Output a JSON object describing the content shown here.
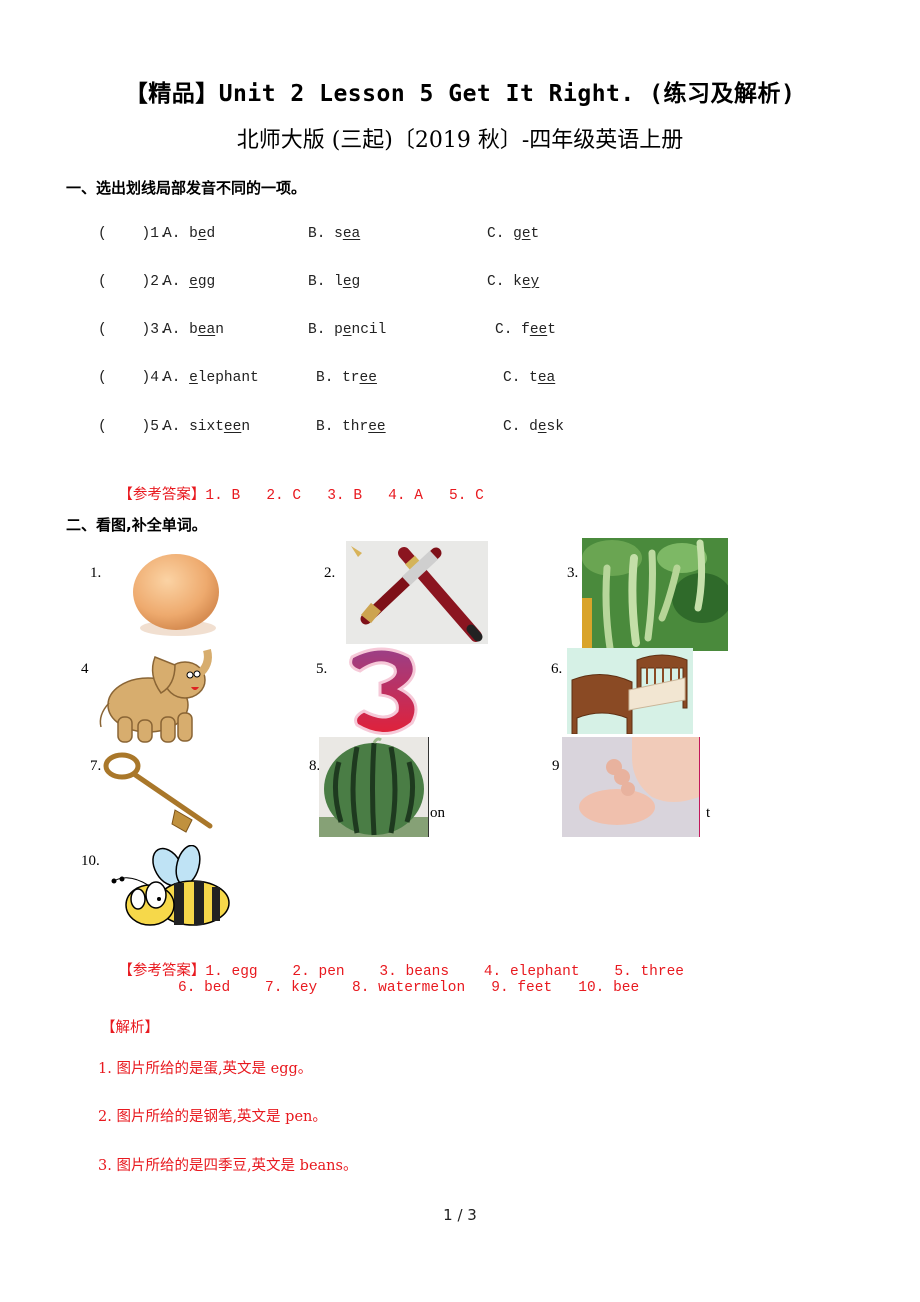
{
  "document": {
    "title_line1": "【精品】Unit 2 Lesson 5 Get It Right. (练习及解析)",
    "title_line2": "北师大版 (三起)〔2019 秋〕-四年级英语上册",
    "page_indicator": "1 / 3"
  },
  "section1": {
    "heading": "一、选出划线局部发音不同的一项。",
    "questions": [
      {
        "blank": "(    )",
        "num": "1.",
        "a": {
          "label": "A.",
          "pre": "b",
          "u": "e",
          "post": "d"
        },
        "b": {
          "label": "B.",
          "pre": "s",
          "u": "ea",
          "post": ""
        },
        "c": {
          "label": "C.",
          "pre": "g",
          "u": "e",
          "post": "t"
        }
      },
      {
        "blank": "(    )",
        "num": "2.",
        "a": {
          "label": "A.",
          "pre": "",
          "u": "e",
          "post": "gg"
        },
        "b": {
          "label": "B.",
          "pre": "l",
          "u": "e",
          "post": "g"
        },
        "c": {
          "label": "C.",
          "pre": "k",
          "u": "ey",
          "post": ""
        }
      },
      {
        "blank": "(    )",
        "num": "3.",
        "a": {
          "label": "A.",
          "pre": "b",
          "u": "ea",
          "post": "n"
        },
        "b": {
          "label": "B.",
          "pre": "p",
          "u": "e",
          "post": "ncil"
        },
        "c": {
          "label": "C.",
          "pre": "f",
          "u": "ee",
          "post": "t"
        }
      },
      {
        "blank": "(    )",
        "num": "4.",
        "a": {
          "label": "A.",
          "pre": "",
          "u": "e",
          "post": "lephant"
        },
        "b": {
          "label": "B.",
          "pre": "tr",
          "u": "ee",
          "post": ""
        },
        "c": {
          "label": "C.",
          "pre": "t",
          "u": "ea",
          "post": ""
        }
      },
      {
        "blank": "(    )",
        "num": "5.",
        "a": {
          "label": "A.",
          "pre": "sixt",
          "u": "ee",
          "post": "n"
        },
        "b": {
          "label": "B.",
          "pre": "thr",
          "u": "ee",
          "post": ""
        },
        "c": {
          "label": "C.",
          "pre": "d",
          "u": "e",
          "post": "sk"
        }
      }
    ],
    "answer_label": "【参考答案】",
    "answers": "1. B   2. C   3. B   4. A   5. C"
  },
  "section2": {
    "heading": "二、看图,补全单词。",
    "pictures": [
      {
        "label": "1.",
        "subject": "egg",
        "suffix": ""
      },
      {
        "label": "2.",
        "subject": "fountain pen",
        "suffix": ""
      },
      {
        "label": "3.",
        "subject": "beans",
        "suffix": ""
      },
      {
        "label": "4",
        "subject": "elephant",
        "suffix": ""
      },
      {
        "label": "5.",
        "subject": "number three",
        "suffix": ""
      },
      {
        "label": "6.",
        "subject": "bed",
        "suffix": ""
      },
      {
        "label": "7.",
        "subject": "key",
        "suffix": ""
      },
      {
        "label": "8.",
        "subject": "watermelon",
        "suffix": "on"
      },
      {
        "label": "9",
        "subject": "feet",
        "suffix": "t"
      },
      {
        "label": "10.",
        "subject": "bee",
        "suffix": ""
      }
    ],
    "answer_label": "【参考答案】",
    "answers_line1": "1. egg    2. pen    3. beans    4. elephant    5. three",
    "answers_line2": "6. bed    7. key    8. watermelon   9. feet   10. bee",
    "analysis_label": "【解析】",
    "analysis": [
      "1.  图片所给的是蛋,英文是 egg。",
      "2.  图片所给的是钢笔,英文是 pen。",
      "3.  图片所给的是四季豆,英文是 beans。"
    ]
  },
  "colors": {
    "answer_red": "#e8191f",
    "text_black": "#000000"
  }
}
